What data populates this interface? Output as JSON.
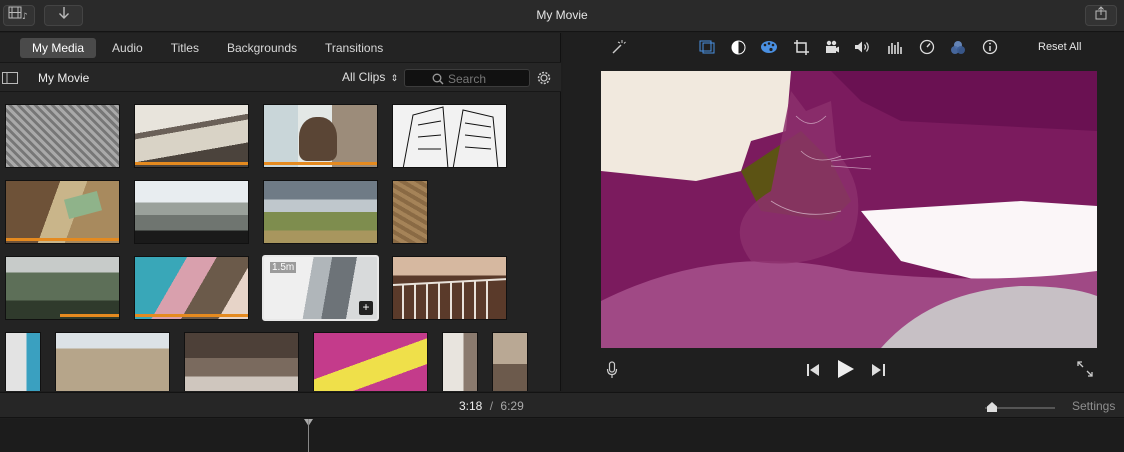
{
  "window": {
    "title": "My Movie"
  },
  "tabs": [
    {
      "label": "My Media",
      "active": true
    },
    {
      "label": "Audio"
    },
    {
      "label": "Titles"
    },
    {
      "label": "Backgrounds"
    },
    {
      "label": "Transitions"
    }
  ],
  "library": {
    "title": "My Movie",
    "filter": "All Clips",
    "search_placeholder": "Search"
  },
  "selected_clip": {
    "duration": "1.5m"
  },
  "icons": {
    "film": "film-music-icon",
    "import": "download-arrow-icon",
    "share": "share-icon",
    "sidebar": "sidebar-toggle-icon",
    "search": "magnifier-icon",
    "settings": "gear-icon",
    "enhance": "magic-wand-icon",
    "color_balance": "color-balance-icon",
    "color_correction": "palette-icon",
    "crop": "crop-icon",
    "stabilize": "camera-icon",
    "volume": "speaker-icon",
    "noise": "equalizer-icon",
    "speed": "speedometer-icon",
    "filter": "clip-filter-icon",
    "info": "info-icon",
    "mic": "microphone-icon",
    "prev": "skip-back-icon",
    "play": "play-icon",
    "next": "skip-forward-icon",
    "fullscreen": "fullscreen-icon"
  },
  "viewer_toolbar": {
    "reset_label": "Reset All"
  },
  "playback": {
    "current": "3:18",
    "separator": "/",
    "total": "6:29"
  },
  "timeline": {
    "settings_label": "Settings"
  },
  "colors": {
    "accent": "#4a90e2",
    "usage_bar": "#e58a1f",
    "viewer_tint": "#7b1b5e"
  }
}
